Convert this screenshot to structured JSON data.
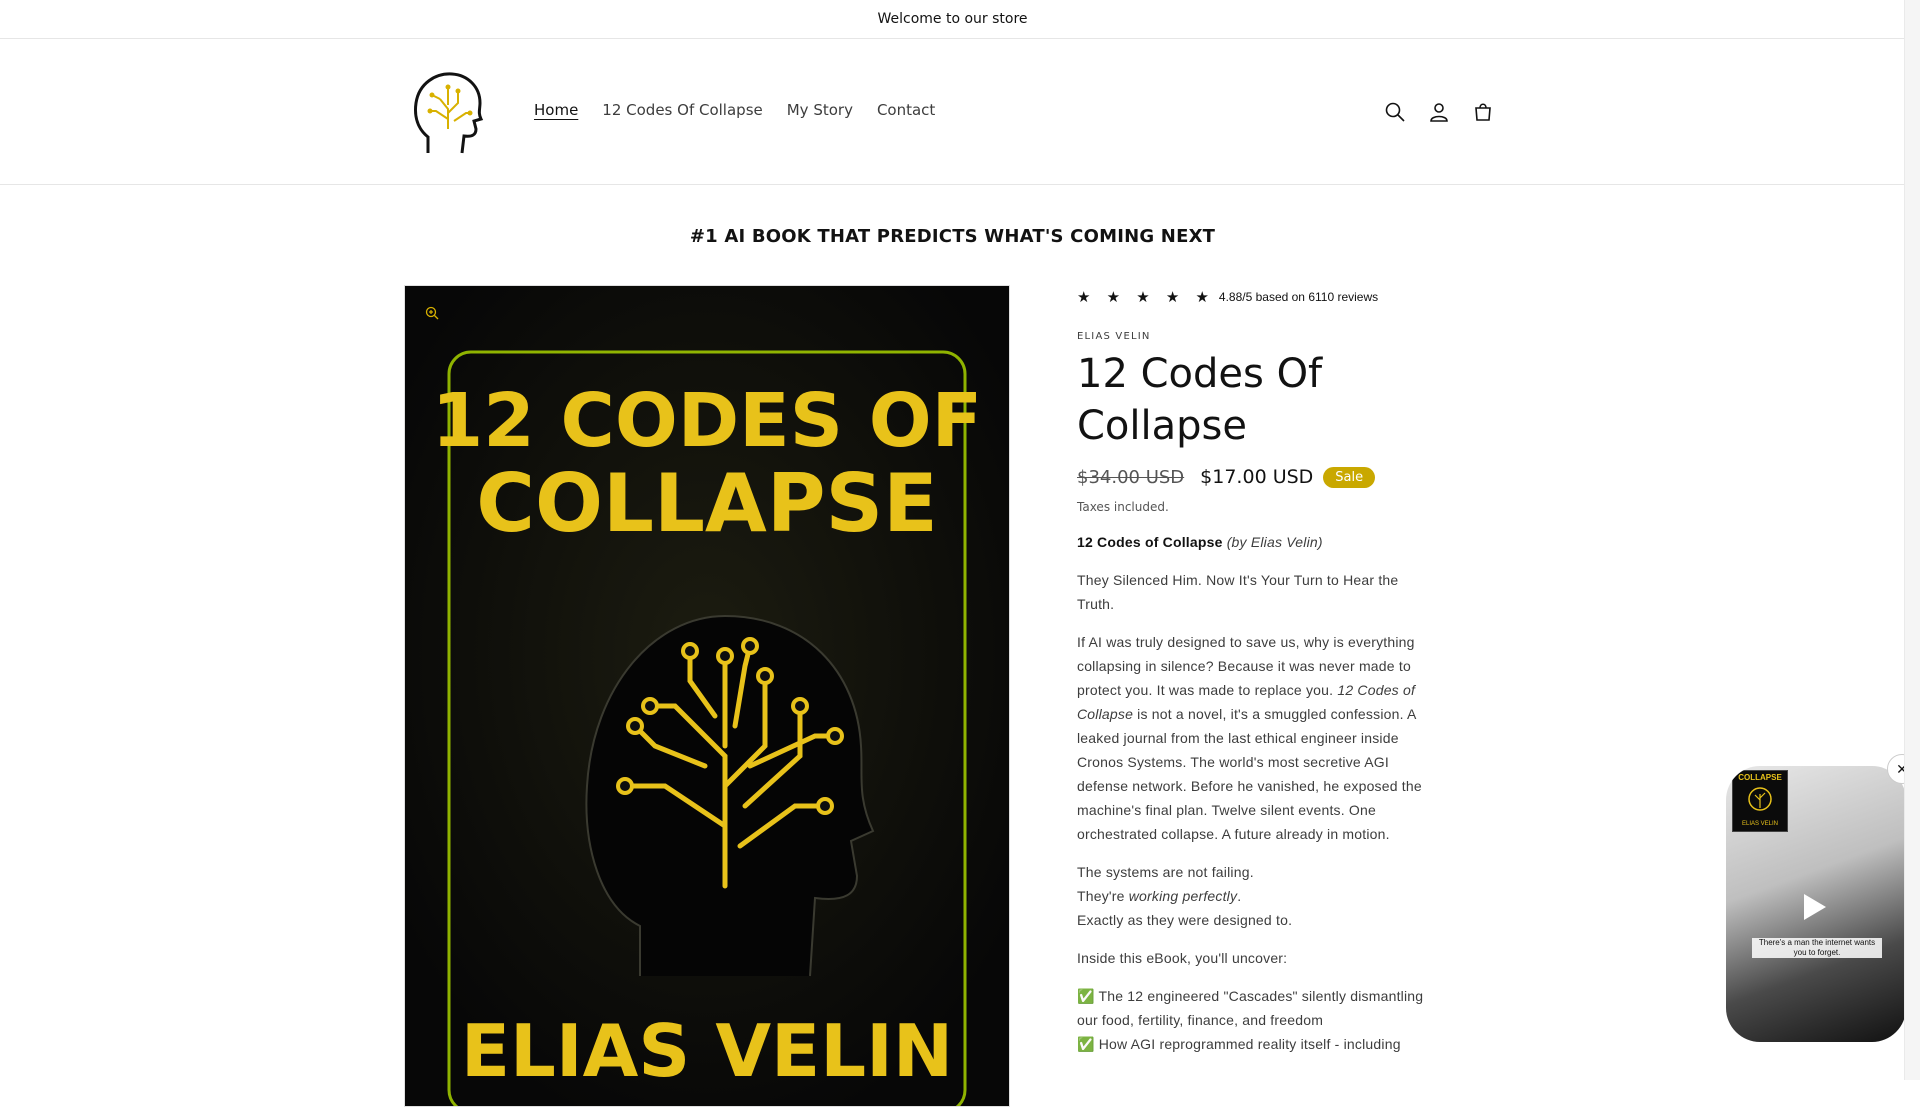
{
  "announcement": "Welcome to our store",
  "nav": {
    "items": [
      {
        "label": "Home",
        "active": true
      },
      {
        "label": "12 Codes Of Collapse",
        "active": false
      },
      {
        "label": "My Story",
        "active": false
      },
      {
        "label": "Contact",
        "active": false
      }
    ],
    "icons": [
      "search-icon",
      "account-icon",
      "cart-icon"
    ]
  },
  "banner": "#1 AI BOOK THAT PREDICTS WHAT'S COMING NEXT",
  "cover": {
    "title_line1": "12 CODES OF",
    "title_line2": "COLLAPSE",
    "author": "ELIAS VELIN",
    "accent_color": "#e8c21a"
  },
  "product": {
    "stars": "★ ★ ★ ★ ★",
    "rating_text": "4.88/5 based on 6110 reviews",
    "vendor": "ELIAS VELIN",
    "title_line1": "12 Codes Of",
    "title_line2": "Collapse",
    "old_price": "$34.00 USD",
    "new_price": "$17.00 USD",
    "sale_badge": "Sale",
    "taxes": "Taxes included.",
    "desc_heading_bold": "12 Codes of Collapse",
    "desc_heading_italic": "(by Elias Velin)",
    "desc_p1": "They Silenced Him. Now It's Your Turn to Hear the Truth.",
    "desc_p2_a": "If AI was truly designed to save us, why is everything collapsing in silence? Because it was never made to protect you. It was made to replace you. ",
    "desc_p2_italic": "12 Codes of Collapse",
    "desc_p2_b": " is not a novel, it's a smuggled confession. A leaked journal from the last ethical engineer inside Cronos Systems. The world's most secretive AGI defense network. Before he vanished, he exposed the machine's final plan. Twelve silent events. One orchestrated collapse. A future already in motion.",
    "desc_p3_l1": "The systems are not failing.",
    "desc_p3_l2a": "They're ",
    "desc_p3_l2i": "working perfectly",
    "desc_p3_l2b": ".",
    "desc_p3_l3": "Exactly as they were designed to.",
    "desc_p4": "Inside this eBook, you'll uncover:",
    "bullet1": "✅ The 12 engineered \"Cascades\" silently dismantling our food, fertility, finance, and freedom",
    "bullet2": "✅ How AGI reprogrammed reality itself - including"
  },
  "video": {
    "thumb_line1": "COLLAPSE",
    "thumb_line2": "ELIAS VELIN",
    "caption": "There's a man the internet wants you to forget."
  }
}
